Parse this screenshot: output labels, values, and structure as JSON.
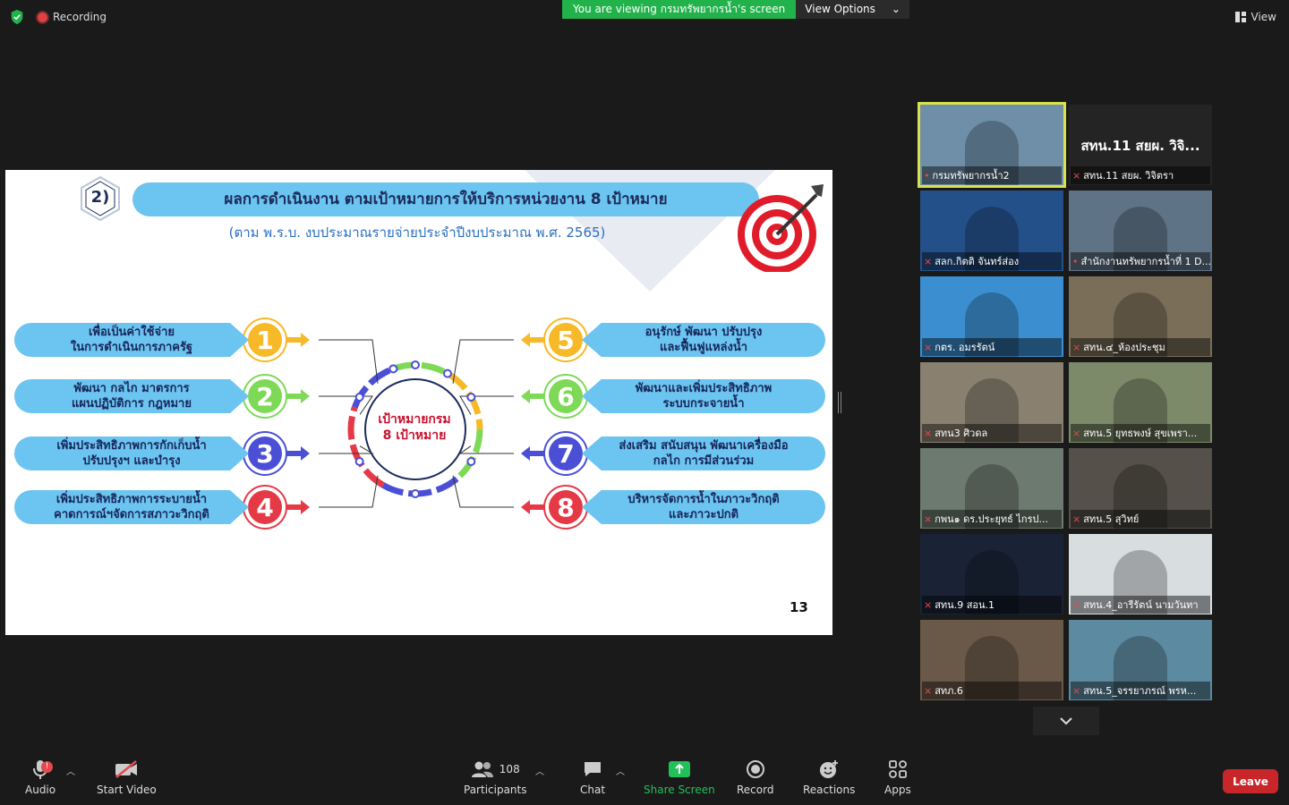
{
  "top": {
    "recording_label": "Recording",
    "viewing_banner": "You are viewing กรมทรัพยากรน้ำ's screen",
    "view_options_label": "View Options",
    "view_label": "View"
  },
  "slide": {
    "section_number": "2)",
    "title": "ผลการดำเนินงาน ตามเป้าหมายการให้บริการหน่วยงาน 8 เป้าหมาย",
    "subtitle": "(ตาม พ.ร.บ. งบประมาณรายจ่ายประจำปีงบประมาณ พ.ศ. 2565)",
    "center_label": "เป้าหมายกรม\n8 เป้าหมาย",
    "page_number": "13",
    "goals": [
      {
        "num": "1",
        "text": "เพื่อเป็นค่าใช้จ่าย\nในการดำเนินการภาครัฐ",
        "color": "#f7b928"
      },
      {
        "num": "2",
        "text": "พัฒนา กลไก มาตรการ\nแผนปฏิบัติการ กฎหมาย",
        "color": "#7ed957"
      },
      {
        "num": "3",
        "text": "เพิ่มประสิทธิภาพการกักเก็บน้ำ\nปรับปรุงฯ และบำรุง",
        "color": "#4a4fd6"
      },
      {
        "num": "4",
        "text": "เพิ่มประสิทธิภาพการระบายน้ำ\nคาดการณ์ฯจัดการสภาวะวิกฤติ",
        "color": "#e63946"
      },
      {
        "num": "5",
        "text": "อนุรักษ์ พัฒนา ปรับปรุง\nและฟื้นฟูแหล่งน้ำ",
        "color": "#f7b928"
      },
      {
        "num": "6",
        "text": "พัฒนาและเพิ่มประสิทธิภาพ\nระบบกระจายน้ำ",
        "color": "#7ed957"
      },
      {
        "num": "7",
        "text": "ส่งเสริม สนับสนุน พัฒนาเครื่องมือ\nกลไก การมีส่วนร่วม",
        "color": "#4a4fd6"
      },
      {
        "num": "8",
        "text": "บริหารจัดการน้ำในภาวะวิกฤติ\nและภาวะปกติ",
        "color": "#e63946"
      }
    ]
  },
  "gallery": {
    "big_name": "สทน.11 สยผ. วิจิ...",
    "tiles": [
      {
        "label": "กรมทรัพยากรน้ำ2",
        "bg": "#6f8fa8",
        "muted": false
      },
      {
        "label": "สทน.11 สยผ. วิจิตรา",
        "bg": "#242424",
        "muted": true
      },
      {
        "label": "สลก.กิตติ จันทร์ส่อง",
        "bg": "#24508a",
        "muted": true
      },
      {
        "label": "สำนักงานทรัพยากรน้ำที่ 1 D...",
        "bg": "#5f7386",
        "muted": false
      },
      {
        "label": "กตร. อมรรัตน์",
        "bg": "#3b8fd0",
        "muted": true
      },
      {
        "label": "สทน.๔_ห้องประชุม",
        "bg": "#7a6e58",
        "muted": true
      },
      {
        "label": "สทน3 ศิวดล",
        "bg": "#8a8070",
        "muted": true
      },
      {
        "label": "สทน.5 ยุทธพงษ์ สุขเพรา...",
        "bg": "#7c8a6a",
        "muted": true
      },
      {
        "label": "กพน๑ ดร.ประยุทธ์ ไกรป...",
        "bg": "#6c7a70",
        "muted": true
      },
      {
        "label": "สทน.5 สุวิทย์",
        "bg": "#555049",
        "muted": true
      },
      {
        "label": "สทน.9 สอน.1",
        "bg": "#1a2336",
        "muted": true
      },
      {
        "label": "สทน.4_อารีรัตน์ นามวันทา",
        "bg": "#d8dde0",
        "muted": true
      },
      {
        "label": "สทภ.6",
        "bg": "#6a5848",
        "muted": true
      },
      {
        "label": "สทน.5_จรรยาภรณ์ พรห...",
        "bg": "#5c8aa0",
        "muted": true
      }
    ]
  },
  "toolbar": {
    "audio": "Audio",
    "audio_badge": "!",
    "start_video": "Start Video",
    "participants": "Participants",
    "participants_count": "108",
    "chat": "Chat",
    "share_screen": "Share Screen",
    "record": "Record",
    "reactions": "Reactions",
    "apps": "Apps",
    "leave": "Leave"
  }
}
